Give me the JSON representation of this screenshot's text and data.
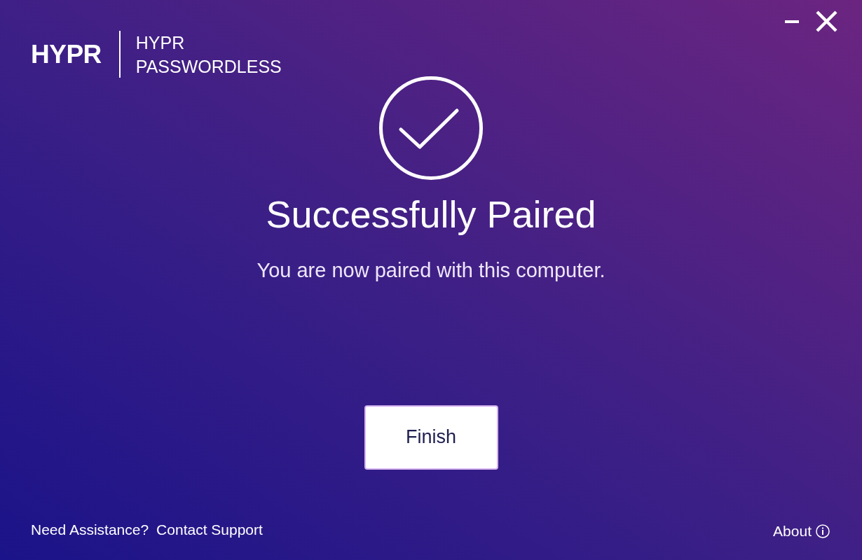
{
  "header": {
    "logo": "HYPR",
    "product_name_lines": [
      "HYPR",
      "PASSWORDLESS"
    ]
  },
  "status": {
    "title": "Successfully Paired",
    "message": "You are now paired with this computer."
  },
  "primary_button": {
    "label": "Finish"
  },
  "footer": {
    "help_text": "Need Assistance?",
    "support_link": "Contact Support",
    "about_link": "About"
  }
}
